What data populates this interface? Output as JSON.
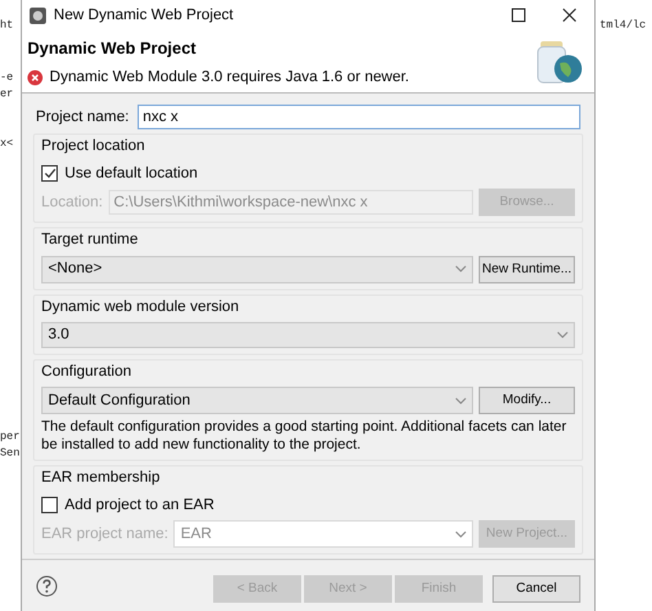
{
  "background": {
    "left_fragments": [
      "ht",
      "-e",
      "er",
      "x<",
      "per",
      "Sen"
    ],
    "right_fragments": [
      "tml4/lc"
    ]
  },
  "window": {
    "title": "New Dynamic Web Project"
  },
  "header": {
    "title": "Dynamic Web Project",
    "message": "Dynamic Web Module 3.0 requires Java 1.6 or newer."
  },
  "project_name": {
    "label": "Project name:",
    "value": "nxc x"
  },
  "project_location": {
    "title": "Project location",
    "use_default": {
      "label": "Use default location",
      "checked": true
    },
    "location": {
      "label": "Location:",
      "value": "C:\\Users\\Kithmi\\workspace-new\\nxc x",
      "disabled": true
    },
    "browse": {
      "label": "Browse...",
      "disabled": true
    }
  },
  "target_runtime": {
    "title": "Target runtime",
    "value": "<None>",
    "button": {
      "label": "New Runtime...",
      "disabled": false
    }
  },
  "module_version": {
    "title": "Dynamic web module version",
    "value": "3.0"
  },
  "configuration": {
    "title": "Configuration",
    "value": "Default Configuration",
    "button": {
      "label": "Modify...",
      "disabled": false
    },
    "description": "The default configuration provides a good starting point. Additional facets can later be installed to add new functionality to the project."
  },
  "ear_membership": {
    "title": "EAR membership",
    "add": {
      "label": "Add project to an EAR",
      "checked": false
    },
    "project_name": {
      "label": "EAR project name:",
      "value": "EAR",
      "disabled": true
    },
    "button": {
      "label": "New Project...",
      "disabled": true
    }
  },
  "buttons": [
    {
      "label": "< Back",
      "disabled": true
    },
    {
      "label": "Next >",
      "disabled": true
    },
    {
      "label": "Finish",
      "disabled": true
    },
    {
      "label": "Cancel",
      "disabled": false
    }
  ]
}
